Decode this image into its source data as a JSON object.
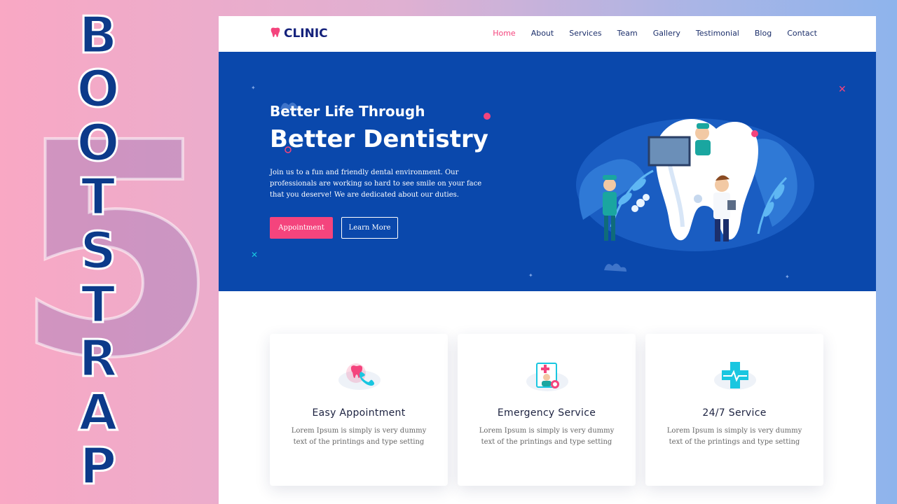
{
  "decor": {
    "big_number": "5",
    "vertical_letters": [
      "B",
      "O",
      "O",
      "T",
      "S",
      "T",
      "R",
      "A",
      "P"
    ]
  },
  "navbar": {
    "logo_text": "CLINIC",
    "links": [
      "Home",
      "About",
      "Services",
      "Team",
      "Gallery",
      "Testimonial",
      "Blog",
      "Contact"
    ],
    "active_link": "Home"
  },
  "hero": {
    "subtitle": "Better Life Through",
    "title": "Better Dentistry",
    "description": "Join us to a fun and friendly dental environment. Our professionals are working so hard to see smile on your face that you deserve! We are dedicated about our duties.",
    "primary_button": "Appointment",
    "secondary_button": "Learn More"
  },
  "features": [
    {
      "icon": "tooth-phone-icon",
      "title": "Easy Appointment",
      "text": "Lorem Ipsum is simply is very dummy text of the printings and type setting"
    },
    {
      "icon": "emergency-doctor-icon",
      "title": "Emergency Service",
      "text": "Lorem Ipsum is simply is very dummy text of the printings and type setting"
    },
    {
      "icon": "medical-cross-icon",
      "title": "24/7 Service",
      "text": "Lorem Ipsum is simply is very dummy text of the printings and type setting"
    }
  ],
  "colors": {
    "brand_pink": "#f4447d",
    "hero_blue": "#0a48ac",
    "navy": "#14217b",
    "accent_cyan": "#19c6e0"
  }
}
